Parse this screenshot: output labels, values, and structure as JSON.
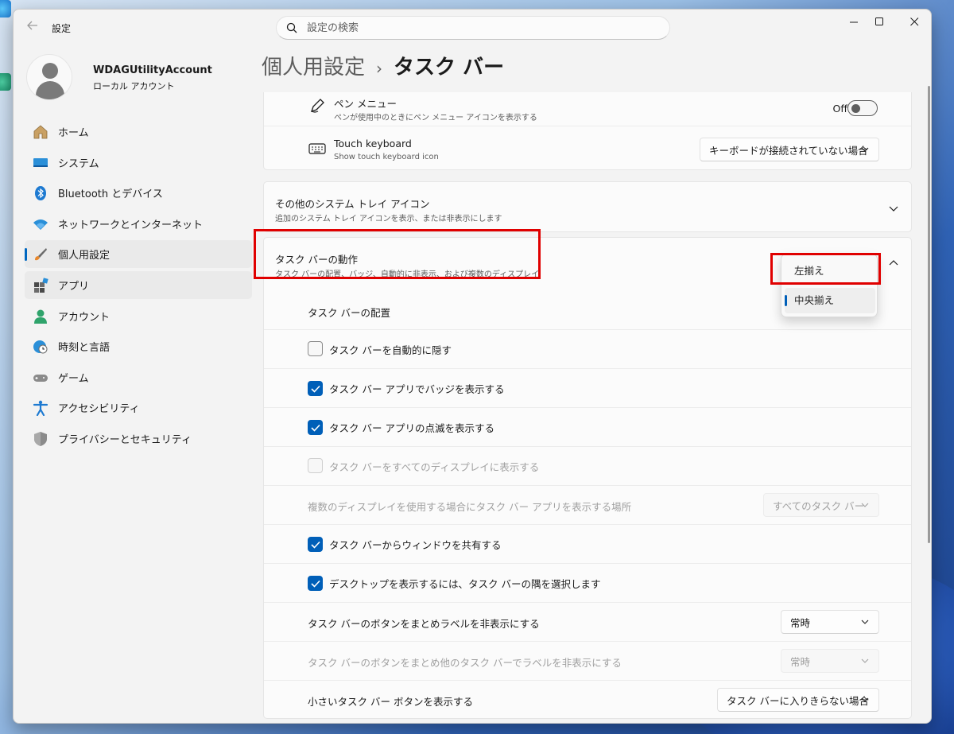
{
  "window": {
    "app_title": "設定",
    "back_icon": "arrow-left-icon",
    "controls": [
      "minimize-icon",
      "maximize-icon",
      "close-icon"
    ]
  },
  "search": {
    "placeholder": "設定の検索"
  },
  "profile": {
    "name": "WDAGUtilityAccount",
    "subtitle": "ローカル アカウント"
  },
  "sidebar": {
    "items": [
      {
        "label": "ホーム",
        "icon": "home-icon"
      },
      {
        "label": "システム",
        "icon": "system-icon"
      },
      {
        "label": "Bluetooth とデバイス",
        "icon": "bluetooth-icon"
      },
      {
        "label": "ネットワークとインターネット",
        "icon": "wifi-icon"
      },
      {
        "label": "個人用設定",
        "icon": "paintbrush-icon",
        "selected": true
      },
      {
        "label": "アプリ",
        "icon": "apps-icon"
      },
      {
        "label": "アカウント",
        "icon": "account-icon"
      },
      {
        "label": "時刻と言語",
        "icon": "globe-clock-icon"
      },
      {
        "label": "ゲーム",
        "icon": "gamepad-icon"
      },
      {
        "label": "アクセシビリティ",
        "icon": "accessibility-icon"
      },
      {
        "label": "プライバシーとセキュリティ",
        "icon": "shield-icon"
      }
    ]
  },
  "breadcrumb": {
    "parent": "個人用設定",
    "separator": "›",
    "current": "タスク バー"
  },
  "pen_menu": {
    "title": "ペン メニュー",
    "subtitle": "ペンが使用中のときにペン メニュー アイコンを表示する",
    "toggle_label": "Off",
    "toggle_on": false
  },
  "touch_keyboard": {
    "title": "Touch keyboard",
    "subtitle": "Show touch keyboard icon",
    "dropdown_value": "キーボードが接続されていない場合"
  },
  "tray_icons": {
    "title": "その他のシステム トレイ アイコン",
    "subtitle": "追加のシステム トレイ アイコンを表示、または非表示にします"
  },
  "behaviors": {
    "title": "タスク バーの動作",
    "subtitle": "タスク バーの配置、バッジ、自動的に非表示、および複数のディスプレイ",
    "alignment_label": "タスク バーの配置",
    "alignment_options": [
      "左揃え",
      "中央揃え"
    ],
    "alignment_selected": "中央揃え",
    "checks": [
      {
        "label": "タスク バーを自動的に隠す",
        "checked": false,
        "enabled": true
      },
      {
        "label": "タスク バー アプリでバッジを表示する",
        "checked": true,
        "enabled": true
      },
      {
        "label": "タスク バー アプリの点滅を表示する",
        "checked": true,
        "enabled": true
      },
      {
        "label": "タスク バーをすべてのディスプレイに表示する",
        "checked": false,
        "enabled": false
      }
    ],
    "multi_display": {
      "label": "複数のディスプレイを使用する場合にタスク バー アプリを表示する場所",
      "value": "すべてのタスク バー",
      "enabled": false
    },
    "checks2": [
      {
        "label": "タスク バーからウィンドウを共有する",
        "checked": true
      },
      {
        "label": "デスクトップを表示するには、タスク バーの隅を選択します",
        "checked": true
      }
    ],
    "combine_main": {
      "label": "タスク バーのボタンをまとめラベルを非表示にする",
      "value": "常時"
    },
    "combine_other": {
      "label": "タスク バーのボタンをまとめ他のタスク バーでラベルを非表示にする",
      "value": "常時",
      "enabled": false
    },
    "small_buttons": {
      "label": "小さいタスク バー ボタンを表示する",
      "value": "タスク バーに入りきらない場合"
    }
  },
  "colors": {
    "accent": "#005fb8",
    "annotation": "#e00000"
  }
}
